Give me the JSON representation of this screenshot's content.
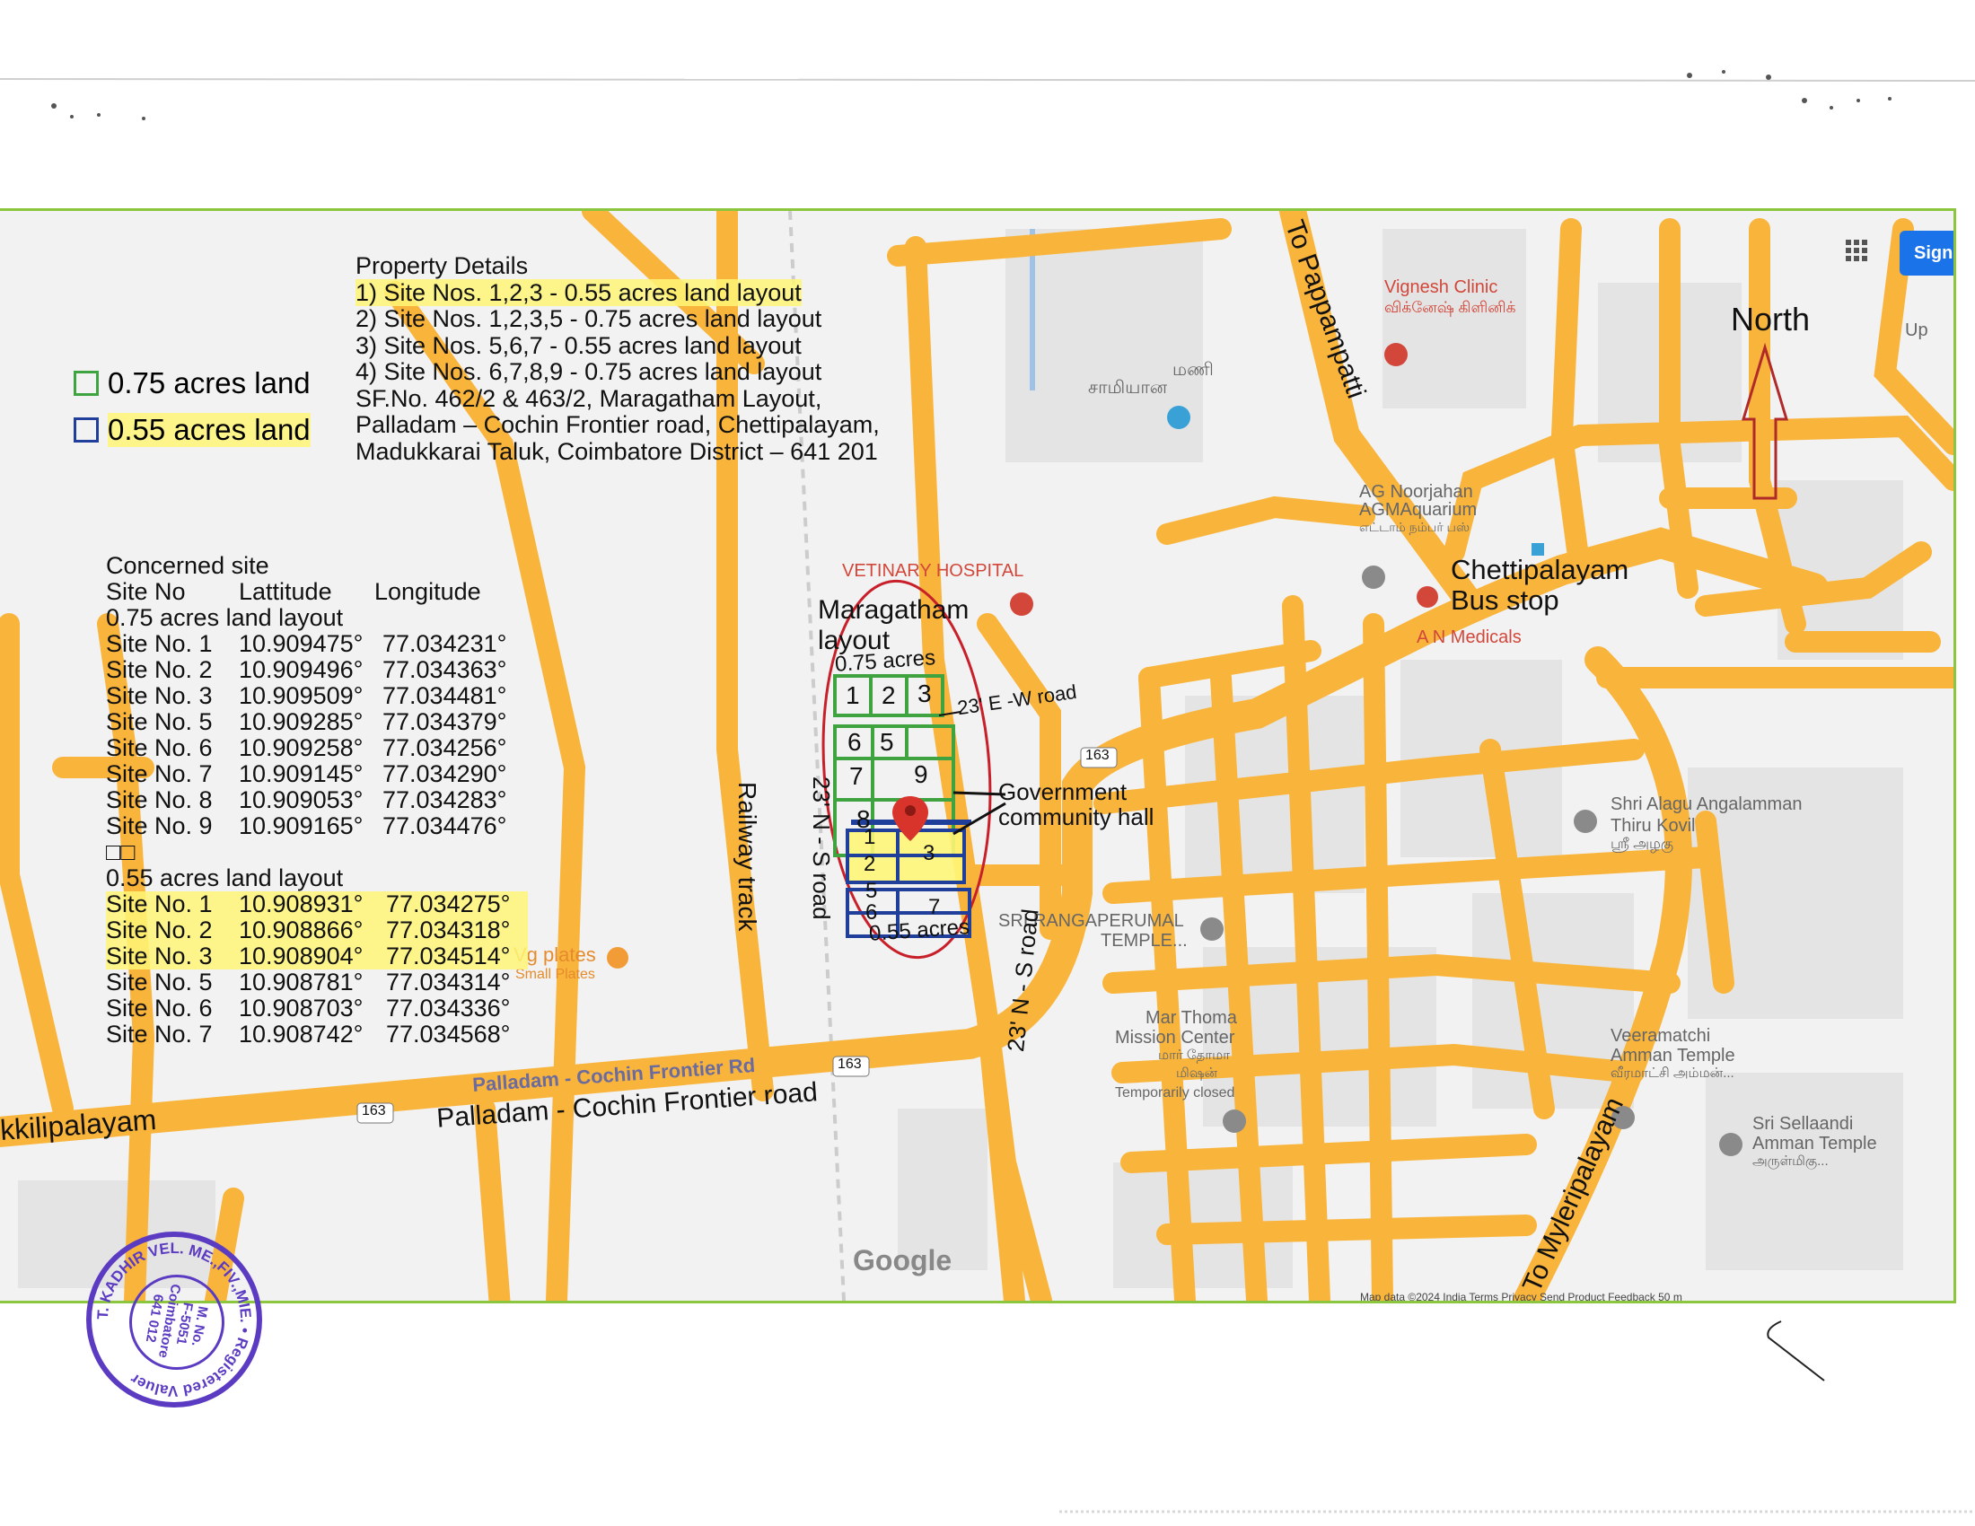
{
  "property_details": {
    "heading": "Property Details",
    "items": [
      "1) Site Nos. 1,2,3 - 0.55 acres land layout",
      "2) Site Nos. 1,2,3,5 - 0.75 acres land layout",
      "3) Site Nos. 5,6,7 - 0.55 acres land layout",
      "4) Site Nos. 6,7,8,9 - 0.75 acres land layout",
      "SF.No. 462/2 & 463/2, Maragatham Layout,",
      "Palladam – Cochin Frontier road, Chettipalayam,",
      "Madukkarai Taluk, Coimbatore District – 641 201"
    ]
  },
  "legend": {
    "items": [
      {
        "label": "0.75 acres land",
        "color": "#3fa33f"
      },
      {
        "label": "0.55 acres land",
        "color": "#1f3f9a"
      }
    ]
  },
  "coordinates": {
    "title": "Concerned site",
    "headers": [
      "Site No",
      "Lattitude",
      "Longitude"
    ],
    "group1_title": "0.75 acres land layout",
    "group1": [
      {
        "site": "Site No. 1",
        "lat": "10.909475°",
        "lon": "77.034231°"
      },
      {
        "site": "Site No. 2",
        "lat": "10.909496°",
        "lon": "77.034363°"
      },
      {
        "site": "Site No. 3",
        "lat": "10.909509°",
        "lon": "77.034481°"
      },
      {
        "site": "Site No. 5",
        "lat": "10.909285°",
        "lon": "77.034379°"
      },
      {
        "site": "Site No. 6",
        "lat": "10.909258°",
        "lon": "77.034256°"
      },
      {
        "site": "Site No. 7",
        "lat": "10.909145°",
        "lon": "77.034290°"
      },
      {
        "site": "Site No. 8",
        "lat": "10.909053°",
        "lon": "77.034283°"
      },
      {
        "site": "Site No. 9",
        "lat": "10.909165°",
        "lon": "77.034476°"
      }
    ],
    "separator": "□□",
    "group2_title": "0.55 acres land layout",
    "group2": [
      {
        "site": "Site No. 1",
        "lat": "10.908931°",
        "lon": "77.034275°"
      },
      {
        "site": "Site No. 2",
        "lat": "10.908866°",
        "lon": "77.034318°"
      },
      {
        "site": "Site No. 3",
        "lat": "10.908904°",
        "lon": "77.034514°"
      },
      {
        "site": "Site No. 5",
        "lat": "10.908781°",
        "lon": "77.034314°"
      },
      {
        "site": "Site No. 6",
        "lat": "10.908703°",
        "lon": "77.034336°"
      },
      {
        "site": "Site No. 7",
        "lat": "10.908742°",
        "lon": "77.034568°"
      }
    ]
  },
  "map": {
    "north_label": "North",
    "to_pappampatti": "To Pappampatti",
    "to_myleripalayam": "To Myleripalayam",
    "chettipalayam_bus_stop_line1": "Chettipalayam",
    "chettipalayam_bus_stop_line2": "Bus stop",
    "maragatham_line1": "Maragatham",
    "maragatham_line2": "layout",
    "acres_075": "0.75 acres",
    "acres_055": "0.55 acres",
    "ew_road": "23' E -W road",
    "ns_road_left": "23' N - S road",
    "ns_road_right": "23' N - S road",
    "railway_track": "Railway track",
    "gov_hall_line1": "Government",
    "gov_hall_line2": "community hall",
    "palladam_road_label": "Palladam - Cochin Frontier road",
    "palladam_map_label": "Palladam - Cochin Frontier Rd",
    "kkilipalayam": "kkilipalayam",
    "road_number": "163",
    "vignesh_clinic": "Vignesh Clinic",
    "vignesh_clinic_ta": "விக்னேஷ் கிளினிக்",
    "mani_ta": "மணி",
    "samiyana_ta": "சாமியான",
    "ag_noorjahan": "AG Noorjahan",
    "agm_aquarium": "AGMAquarium",
    "agm_ta": "எட்டாம் நம்பர் பஸ்",
    "vetinary_hospital": "VETINARY HOSPITAL",
    "an_medicals": "A N Medicals",
    "shri_alagu": "Shri Alagu Angalamman",
    "thiru_kovil": "Thiru Kovil",
    "thiru_kovil_ta": "ஸ்ரீ அழகு",
    "sri_rangaperumal": "SRI RANGAPERUMAL",
    "temple": "TEMPLE...",
    "veg_plates": "Vg plates",
    "small_plates": "Small Plates",
    "mar_thoma": "Mar Thoma",
    "mission_center": "Mission Center",
    "mar_thoma_ta1": "மார் தோமா",
    "mar_thoma_ta2": "மிஷன்",
    "temporarily_closed": "Temporarily closed",
    "veeramatchi": "Veeramatchi",
    "amman_temple": "Amman Temple",
    "veeramatchi_ta": "வீரமாட்சி அம்மன்...",
    "sri_sellaandi": "Sri Sellaandi",
    "amman_temple2": "Amman Temple",
    "sellaandi_ta": "அருள்மிகு...",
    "up_label": "Up",
    "sign_in": "Sign",
    "google": "Google",
    "footer": "Map data ©2024   India   Terms   Privacy   Send Product Feedback   50 m",
    "site_numbers_top": [
      "1",
      "2",
      "3"
    ],
    "site_numbers_mid": [
      "6",
      "5",
      "7",
      "9",
      "8"
    ],
    "site_numbers_bottom": [
      "1",
      "2",
      "3",
      "5",
      "6",
      "7"
    ]
  },
  "stamp": {
    "name": "T. KADHIR VEL. ME.,FIV.,MIE.",
    "line1": "M. No.",
    "line2": "F-5051",
    "line3": "Coimbatore",
    "line4": "641 012",
    "ring_text": "Registered Valuer"
  },
  "colors": {
    "road": "#f9b43c",
    "frame": "#8cc63f",
    "green_layout": "#3fa33f",
    "blue_layout": "#1f3f9a",
    "highlight": "#fff678",
    "red_ellipse": "#c8202a",
    "stamp": "#5b3bc2"
  }
}
